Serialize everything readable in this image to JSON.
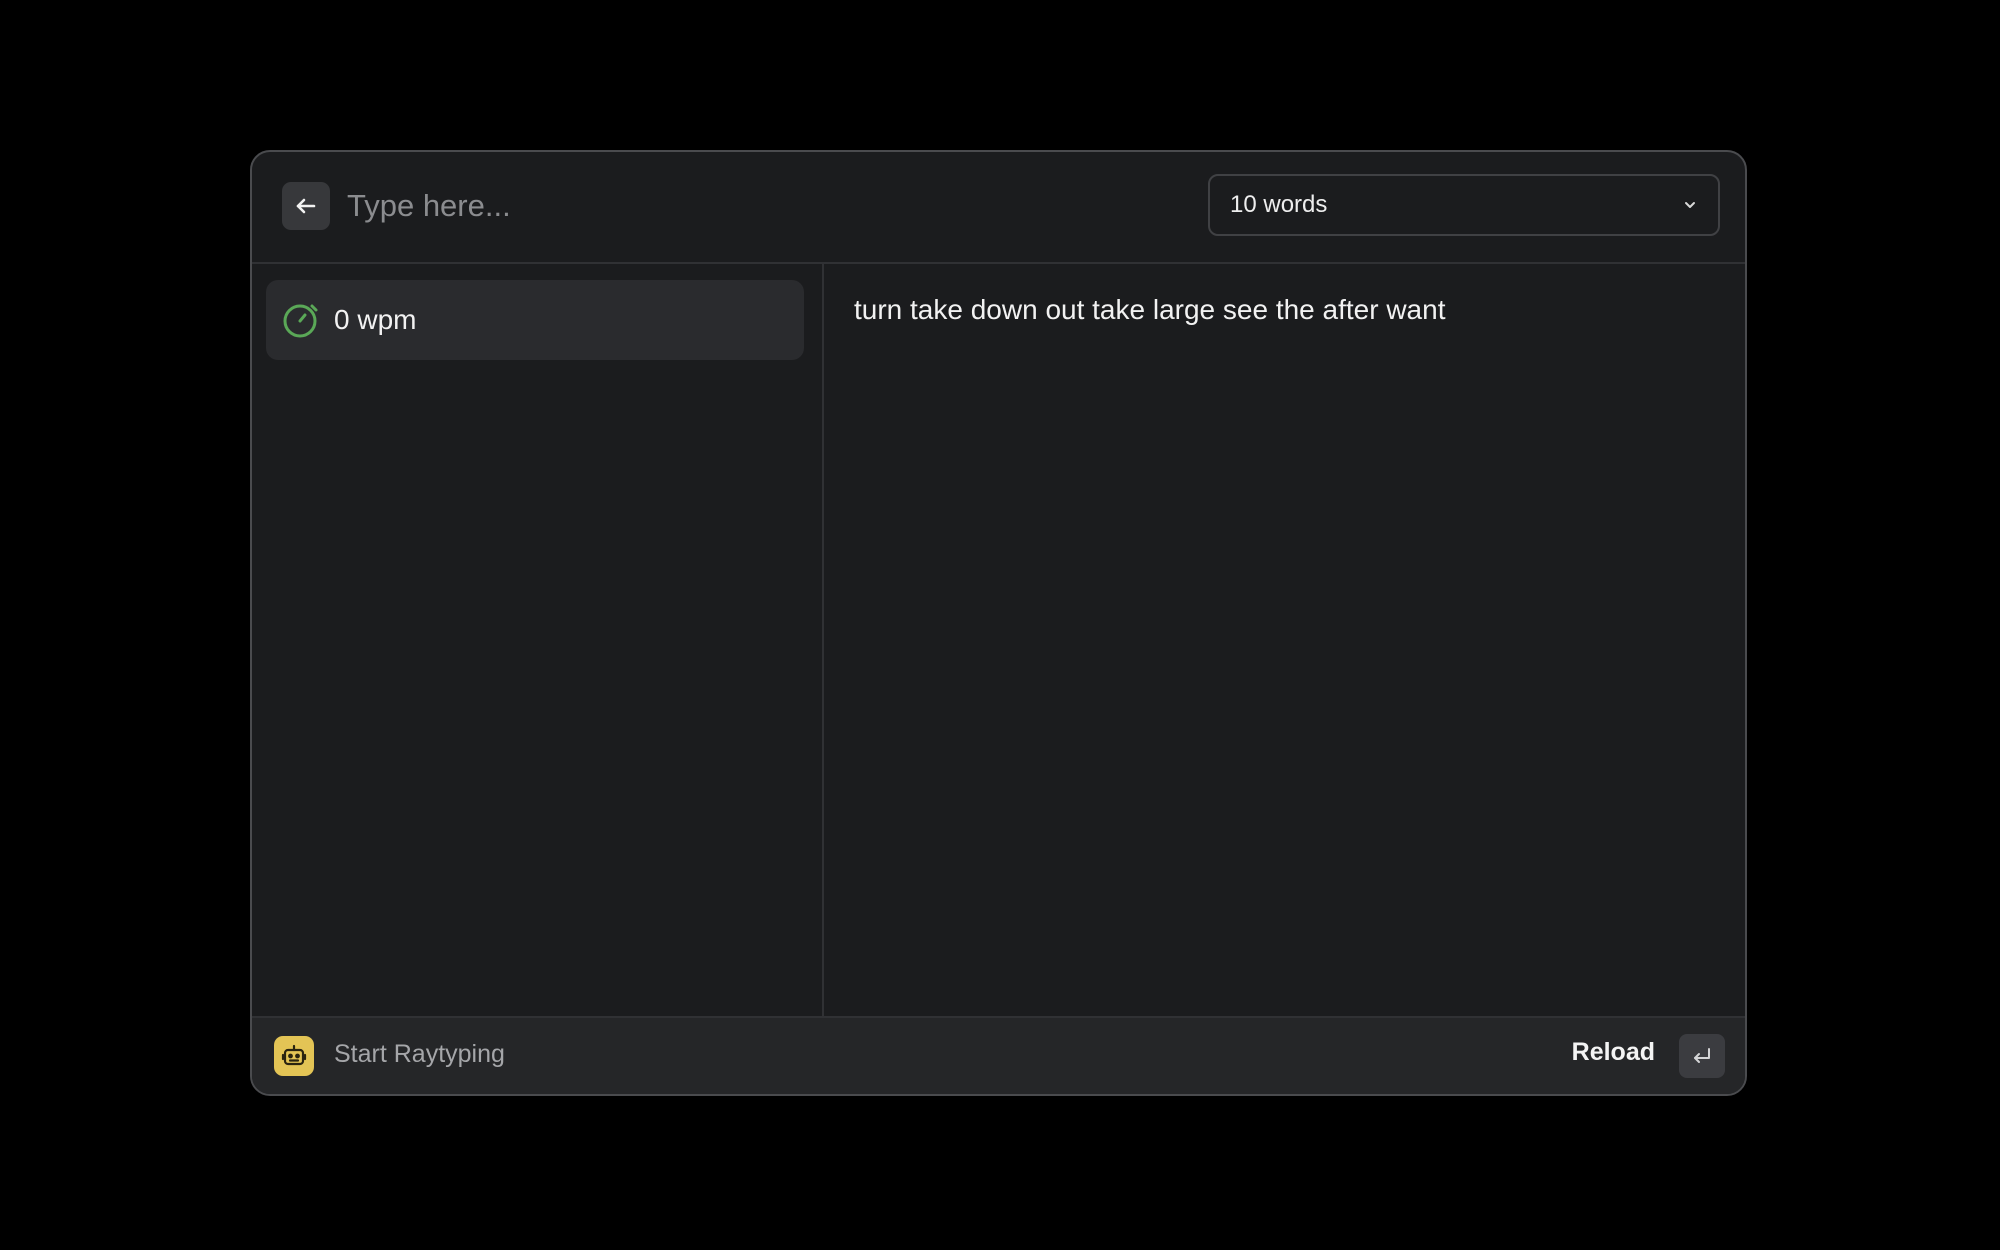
{
  "search": {
    "placeholder": "Type here...",
    "value": ""
  },
  "icons": {
    "back": "arrow-left-icon",
    "dropdown": "chevron-down-icon",
    "stat": "stopwatch-icon",
    "extension": "robot-icon",
    "enter": "return-key-icon"
  },
  "dropdown": {
    "selected": "10 words"
  },
  "list": {
    "items": [
      {
        "label": "0 wpm"
      }
    ]
  },
  "detail": {
    "text": "turn take down out take large see the after want"
  },
  "footer": {
    "title": "Start Raytyping",
    "action_label": "Reload"
  },
  "colors": {
    "accent_green": "#5aa857",
    "logo_yellow": "#e3c455",
    "background": "#1b1c1e"
  }
}
